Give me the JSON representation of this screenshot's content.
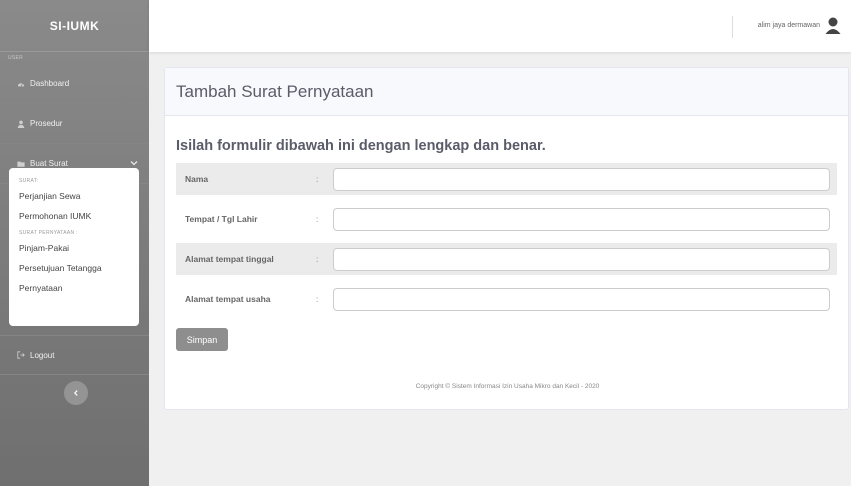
{
  "app": {
    "brand": "SI-IUMK"
  },
  "sidebar": {
    "section_label": "USER",
    "items": [
      {
        "label": "Dashboard",
        "icon": "dashboard-icon"
      },
      {
        "label": "Prosedur",
        "icon": "user-icon"
      },
      {
        "label": "Buat Surat",
        "icon": "folder-icon"
      },
      {
        "label": "Logout",
        "icon": "logout-icon"
      }
    ],
    "submenu": {
      "head1": "SURAT:",
      "items1": [
        "Perjanjian Sewa",
        "Permohonan IUMK"
      ],
      "head2": "SURAT PERNYATAAN :",
      "items2": [
        "Pinjam-Pakai",
        "Persetujuan Tetangga",
        "Pernyataan"
      ]
    }
  },
  "topbar": {
    "user_name": "alim jaya dermawan"
  },
  "card": {
    "title": "Tambah Surat Pernyataan",
    "form_heading": "Isilah formulir dibawah ini dengan lengkap dan benar.",
    "fields": [
      {
        "label": "Nama",
        "colon": ":",
        "value": ""
      },
      {
        "label": "Tempat / Tgl Lahir",
        "colon": ":",
        "value": ""
      },
      {
        "label": "Alamat tempat tinggal",
        "colon": ":",
        "value": ""
      },
      {
        "label": "Alamat tempat usaha",
        "colon": ":",
        "value": ""
      }
    ],
    "save_label": "Simpan",
    "footer": "Copyright © Sistem Informasi Izin Usaha Mikro dan Kecil - 2020"
  }
}
